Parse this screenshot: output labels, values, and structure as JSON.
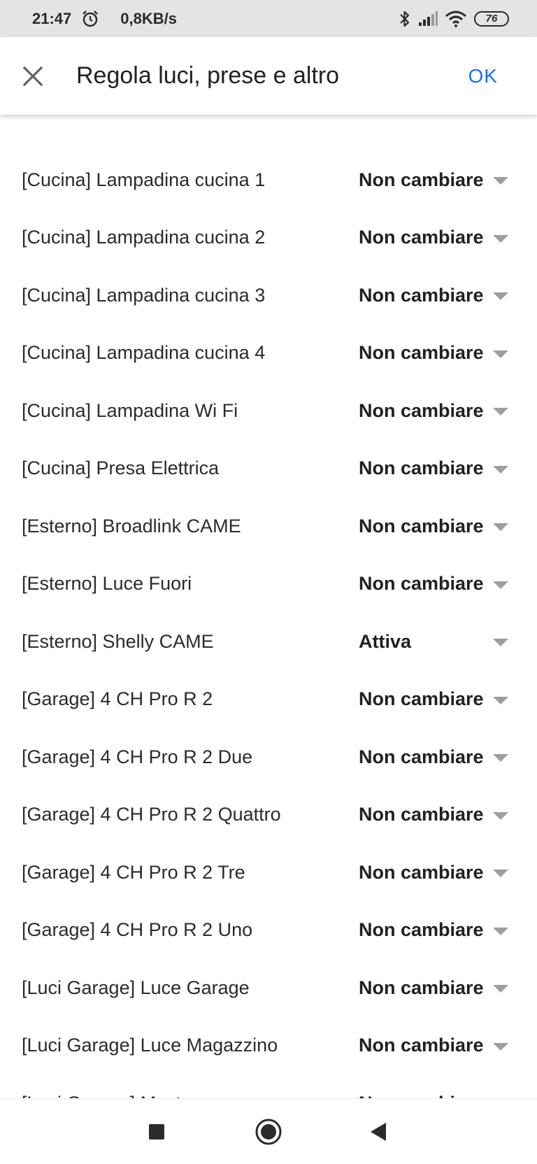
{
  "status_bar": {
    "time": "21:47",
    "net_speed": "0,8KB/s",
    "battery": "76",
    "icons": [
      "alarm-icon",
      "bluetooth-icon",
      "signal-icon",
      "wifi-icon",
      "battery-icon"
    ]
  },
  "app_bar": {
    "title": "Regola luci, prese e altro",
    "ok_label": "OK",
    "close_icon": "close-icon",
    "accent_color": "#1a73e8"
  },
  "devices": [
    {
      "name": "[Cucina] Lampadina cucina 1",
      "value": "Non cambiare"
    },
    {
      "name": "[Cucina] Lampadina cucina 2",
      "value": "Non cambiare"
    },
    {
      "name": "[Cucina] Lampadina cucina 3",
      "value": "Non cambiare"
    },
    {
      "name": "[Cucina] Lampadina cucina 4",
      "value": "Non cambiare"
    },
    {
      "name": "[Cucina] Lampadina Wi Fi",
      "value": "Non cambiare"
    },
    {
      "name": "[Cucina] Presa Elettrica",
      "value": "Non cambiare"
    },
    {
      "name": "[Esterno] Broadlink CAME",
      "value": "Non cambiare"
    },
    {
      "name": "[Esterno] Luce Fuori",
      "value": "Non cambiare"
    },
    {
      "name": "[Esterno] Shelly CAME",
      "value": "Attiva"
    },
    {
      "name": "[Garage] 4 CH Pro R 2",
      "value": "Non cambiare"
    },
    {
      "name": "[Garage] 4 CH Pro R 2 Due",
      "value": "Non cambiare"
    },
    {
      "name": "[Garage] 4 CH Pro R 2 Quattro",
      "value": "Non cambiare"
    },
    {
      "name": "[Garage] 4 CH Pro R 2 Tre",
      "value": "Non cambiare"
    },
    {
      "name": "[Garage] 4 CH Pro R 2 Uno",
      "value": "Non cambiare"
    },
    {
      "name": "[Luci Garage] Luce Garage",
      "value": "Non cambiare"
    },
    {
      "name": "[Luci Garage] Luce Magazzino",
      "value": "Non cambiare"
    },
    {
      "name": "[Luci Garage] Mast",
      "value": "Non cambiare"
    }
  ],
  "nav_bar": {
    "icons": [
      "recents-square-icon",
      "home-circle-icon",
      "back-triangle-icon"
    ]
  }
}
